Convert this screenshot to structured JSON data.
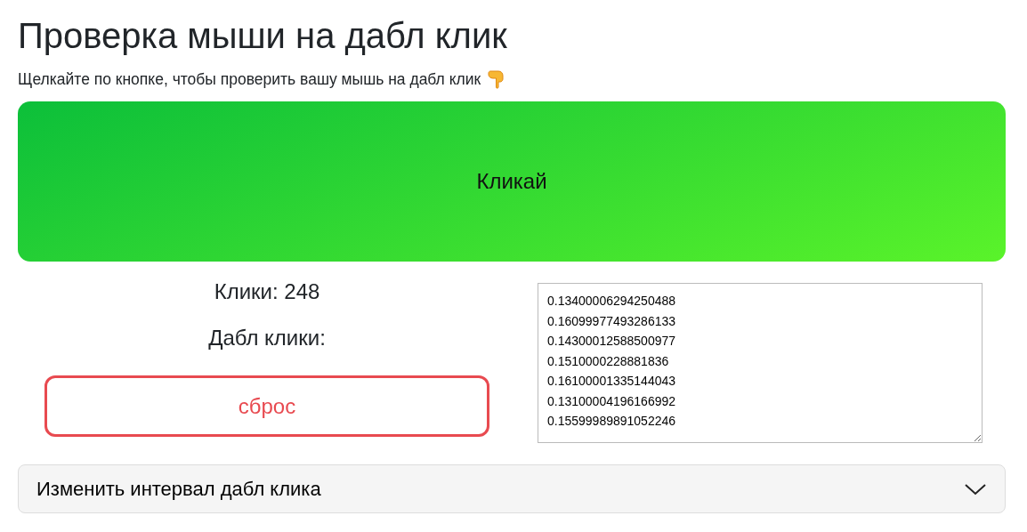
{
  "title": "Проверка мыши на дабл клик",
  "subtitle": "Щелкайте по кнопке, чтобы проверить вашу мышь на дабл клик",
  "click_button": {
    "label": "Кликай"
  },
  "clicks": "Клики: 248",
  "double_clicks": "Дабл клики:",
  "reset_button": {
    "label": "сброс"
  },
  "intervals": [
    "0.13400006294250488",
    "0.16099977493286133",
    "0.14300012588500977",
    "0.1510000228881836",
    "0.16100001335144043",
    "0.13100004196166992",
    "0.15599989891052246"
  ],
  "accordion": {
    "title": "Изменить интервал дабл клика",
    "expanded": false
  }
}
